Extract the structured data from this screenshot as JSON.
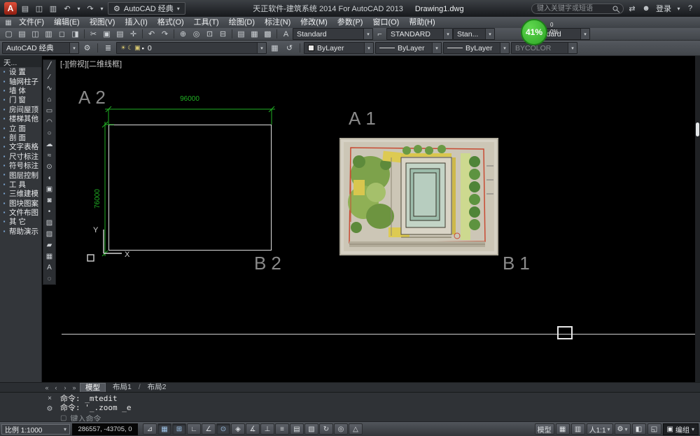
{
  "colors": {
    "dimension_green": "#21b024",
    "badge_green": "#3fc435",
    "logo_red": "#c3331f"
  },
  "titlebar": {
    "workspace": "AutoCAD 经典",
    "app_title": "天正软件-建筑系统 2014  For AutoCAD 2013",
    "doc_title": "Drawing1.dwg",
    "search_placeholder": "键入关键字或短语",
    "login_label": "登录"
  },
  "menubar": {
    "items": [
      "文件(F)",
      "编辑(E)",
      "视图(V)",
      "插入(I)",
      "格式(O)",
      "工具(T)",
      "绘图(D)",
      "标注(N)",
      "修改(M)",
      "参数(P)",
      "窗口(O)",
      "帮助(H)"
    ]
  },
  "toolbar1": {
    "icons": [
      "▢",
      "▤",
      "◫",
      "▥",
      "◻",
      "◨",
      "✂",
      "▣",
      "▤",
      "✛",
      "↶",
      "↷",
      "⊕",
      "◎",
      "⊡",
      "⊟",
      "▤",
      "▦",
      "▩"
    ],
    "text_style": "Standard",
    "dim_style": "STANDARD",
    "table_style": "Stan...",
    "mleader_style": "Standard",
    "badge_percent": "41%",
    "badge_top": "0",
    "badge_bottom": "0%"
  },
  "toolbar2": {
    "workspace": "AutoCAD 经典",
    "layer_name": "0",
    "color": "ByLayer",
    "linetype": "ByLayer",
    "lineweight": "ByLayer",
    "plot_style": "BYCOLOR"
  },
  "sidebar": {
    "header": "天...",
    "items": [
      "设  置",
      "轴网柱子",
      "墙  体",
      "门  窗",
      "房间屋顶",
      "楼梯其他",
      "立  面",
      "剖  面",
      "文字表格",
      "尺寸标注",
      "符号标注",
      "图层控制",
      "工  具",
      "三维建模",
      "图块图案",
      "文件布图",
      "其  它",
      "帮助演示"
    ]
  },
  "draw_toolbar": {
    "icons": [
      "╱",
      "∕",
      "∿",
      "⌂",
      "▭",
      "◠",
      "○",
      "☁",
      "≈",
      "⊙",
      "◖",
      "▣",
      "◙",
      "•",
      "▨",
      "▧",
      "▰",
      "▦",
      "A",
      "◌"
    ]
  },
  "canvas": {
    "viewport_label": "[-][俯视][二维线框]",
    "label_a2": "A2",
    "label_b2": "B2",
    "label_a1": "A1",
    "label_b1": "B1",
    "dim_horizontal": "96000",
    "dim_vertical": "76000",
    "axis_x": "X",
    "axis_y": "Y"
  },
  "layout_tabs": {
    "model": "模型",
    "layout1": "布局1",
    "layout2": "布局2"
  },
  "command": {
    "line1": "命令: _mtedit",
    "line2": "命令: '_.zoom _e",
    "prompt_placeholder": "键入命令"
  },
  "statusbar": {
    "scale": "比例 1:1000",
    "coords": "286557, -43705, 0",
    "toggles": [
      "⊿",
      "▦",
      "⊞",
      "∟",
      "∠",
      "⊙",
      "◈",
      "∡",
      "⊥",
      "≡",
      "▤",
      "▧",
      "↻",
      "◎",
      "△"
    ],
    "model_label": "模型",
    "annotation_scale": "人1:1",
    "group_label": "编组"
  },
  "icons": {
    "logo": "A",
    "window": "▦",
    "open": "▤",
    "save": "◫",
    "plot": "▥",
    "undo": "↶",
    "redo": "↷",
    "caret": "▾",
    "gear": "⚙",
    "sync": "⇄",
    "user": "☻",
    "help": "?",
    "style_a": "A",
    "dim_mark": "⌐",
    "layer_stack": "≣",
    "layer_states": "▦",
    "layer_prev": "↺",
    "sun": "☀",
    "moon": "☾",
    "lock": "▣",
    "chip": "▪",
    "bullet": "▪",
    "nav_first": "«",
    "nav_prev": "‹",
    "nav_next": "›",
    "nav_last": "»",
    "slash": "/",
    "close": "×",
    "wrench": "⚙",
    "prompt_box": "▢",
    "qv_layouts": "▦",
    "qv_drawings": "▥",
    "clean": "◱",
    "lock2": "◧",
    "group_icon": "▣"
  }
}
